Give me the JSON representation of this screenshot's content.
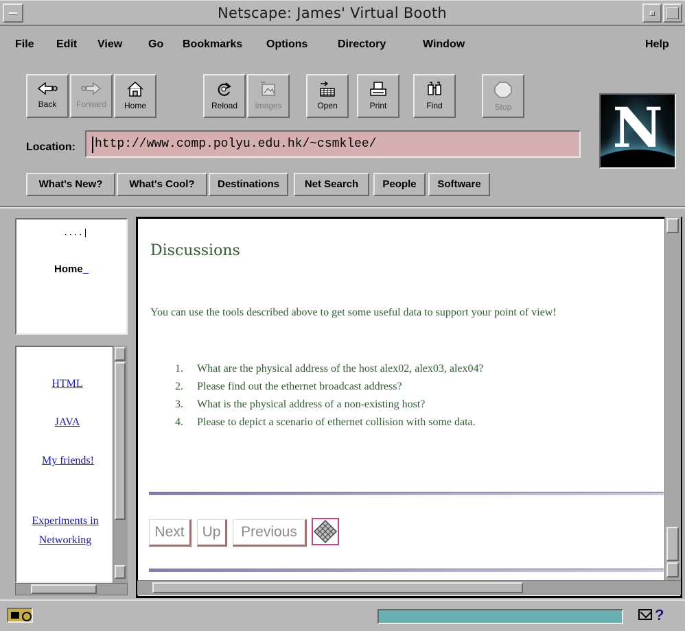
{
  "window": {
    "title": "Netscape: James' Virtual Booth"
  },
  "menubar": {
    "items": [
      "File",
      "Edit",
      "View",
      "Go",
      "Bookmarks",
      "Options",
      "Directory",
      "Window",
      "Help"
    ]
  },
  "toolbar": {
    "buttons": [
      {
        "label": "Back",
        "icon": "back-arrow-icon",
        "enabled": true
      },
      {
        "label": "Forward",
        "icon": "forward-arrow-icon",
        "enabled": false
      },
      {
        "label": "Home",
        "icon": "home-icon",
        "enabled": true
      },
      {
        "label": "Reload",
        "icon": "reload-icon",
        "enabled": true
      },
      {
        "label": "Images",
        "icon": "images-icon",
        "enabled": false
      },
      {
        "label": "Open",
        "icon": "open-icon",
        "enabled": true
      },
      {
        "label": "Print",
        "icon": "print-icon",
        "enabled": true
      },
      {
        "label": "Find",
        "icon": "find-icon",
        "enabled": true
      },
      {
        "label": "Stop",
        "icon": "stop-icon",
        "enabled": false
      }
    ],
    "logo_letter": "N"
  },
  "location": {
    "label": "Location:",
    "url": "http://www.comp.polyu.edu.hk/~csmklee/"
  },
  "directory_buttons": [
    "What's New?",
    "What's Cool?",
    "Destinations",
    "Net Search",
    "People",
    "Software"
  ],
  "left_top_frame": {
    "mark": "....|",
    "home_label": "Home",
    "home_suffix": "_"
  },
  "left_nav": {
    "links": [
      {
        "label": "HTML"
      },
      {
        "label": "JAVA"
      },
      {
        "label": "My friends!"
      },
      {
        "label": "Experiments in Networking"
      }
    ]
  },
  "content": {
    "heading": "Discussions",
    "paragraph": "You can use the tools described above to get some useful data to support your point of view!",
    "list": [
      {
        "num": "1.",
        "text": "What are the physical address of the host alex02, alex03, alex04?"
      },
      {
        "num": "2.",
        "text": "Please find out the ethernet broadcast address?"
      },
      {
        "num": "3.",
        "text": "What is the physical address of a non-existing host?"
      },
      {
        "num": "4.",
        "text": "Please to depict a scenario of ethernet collision with some data."
      }
    ],
    "nav": {
      "next": "Next",
      "up": "Up",
      "previous": "Previous"
    }
  },
  "statusbar": {
    "help": "?"
  },
  "colors": {
    "content_text": "#2f5e2f",
    "link": "#1515c8",
    "location_bg": "#d6b0b0",
    "progress": "#6ab0b0"
  }
}
